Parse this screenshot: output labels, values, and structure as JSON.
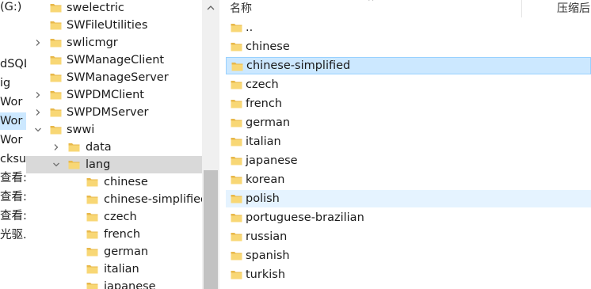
{
  "left_fragments": [
    {
      "text": "(G:)",
      "selected": false
    },
    {
      "text": "",
      "selected": false
    },
    {
      "text": "",
      "selected": false
    },
    {
      "text": "dSQL",
      "selected": false
    },
    {
      "text": "ig",
      "selected": false
    },
    {
      "text": "Wor",
      "selected": false
    },
    {
      "text": "Wor",
      "selected": true
    },
    {
      "text": "Wor",
      "selected": false
    },
    {
      "text": "cksu",
      "selected": false
    },
    {
      "text": "查看:",
      "selected": false
    },
    {
      "text": "查看:",
      "selected": false
    },
    {
      "text": "查看:",
      "selected": false
    },
    {
      "text": "光驱.e",
      "selected": false
    }
  ],
  "tree": [
    {
      "label": "swelectric",
      "level": 0,
      "expand": "none",
      "selected": false
    },
    {
      "label": "SWFileUtilities",
      "level": 0,
      "expand": "none",
      "selected": false
    },
    {
      "label": "swlicmgr",
      "level": 0,
      "expand": "collapsed",
      "selected": false
    },
    {
      "label": "SWManageClient",
      "level": 0,
      "expand": "none",
      "selected": false
    },
    {
      "label": "SWManageServer",
      "level": 0,
      "expand": "none",
      "selected": false
    },
    {
      "label": "SWPDMClient",
      "level": 0,
      "expand": "collapsed",
      "selected": false
    },
    {
      "label": "SWPDMServer",
      "level": 0,
      "expand": "collapsed",
      "selected": false
    },
    {
      "label": "swwi",
      "level": 0,
      "expand": "expanded",
      "selected": false
    },
    {
      "label": "data",
      "level": 1,
      "expand": "collapsed",
      "selected": false
    },
    {
      "label": "lang",
      "level": 1,
      "expand": "expanded",
      "selected": true
    },
    {
      "label": "chinese",
      "level": 2,
      "expand": "none",
      "selected": false
    },
    {
      "label": "chinese-simplified",
      "level": 2,
      "expand": "none",
      "selected": false
    },
    {
      "label": "czech",
      "level": 2,
      "expand": "none",
      "selected": false
    },
    {
      "label": "french",
      "level": 2,
      "expand": "none",
      "selected": false
    },
    {
      "label": "german",
      "level": 2,
      "expand": "none",
      "selected": false
    },
    {
      "label": "italian",
      "level": 2,
      "expand": "none",
      "selected": false
    },
    {
      "label": "japanese",
      "level": 2,
      "expand": "none",
      "selected": false
    }
  ],
  "list_header": {
    "name": "名称",
    "compressed": "压缩后"
  },
  "files": [
    {
      "label": "..",
      "state": "normal"
    },
    {
      "label": "chinese",
      "state": "normal"
    },
    {
      "label": "chinese-simplified",
      "state": "selected"
    },
    {
      "label": "czech",
      "state": "normal"
    },
    {
      "label": "french",
      "state": "normal"
    },
    {
      "label": "german",
      "state": "normal"
    },
    {
      "label": "italian",
      "state": "normal"
    },
    {
      "label": "japanese",
      "state": "normal"
    },
    {
      "label": "korean",
      "state": "normal"
    },
    {
      "label": "polish",
      "state": "hover"
    },
    {
      "label": "portuguese-brazilian",
      "state": "normal"
    },
    {
      "label": "russian",
      "state": "normal"
    },
    {
      "label": "spanish",
      "state": "normal"
    },
    {
      "label": "turkish",
      "state": "normal"
    }
  ],
  "colors": {
    "folder": "#f8d775",
    "folder_dark": "#e8b84a",
    "selected": "#cce8ff",
    "hover": "#e5f3ff",
    "tree_selected": "#d9d9d9"
  }
}
